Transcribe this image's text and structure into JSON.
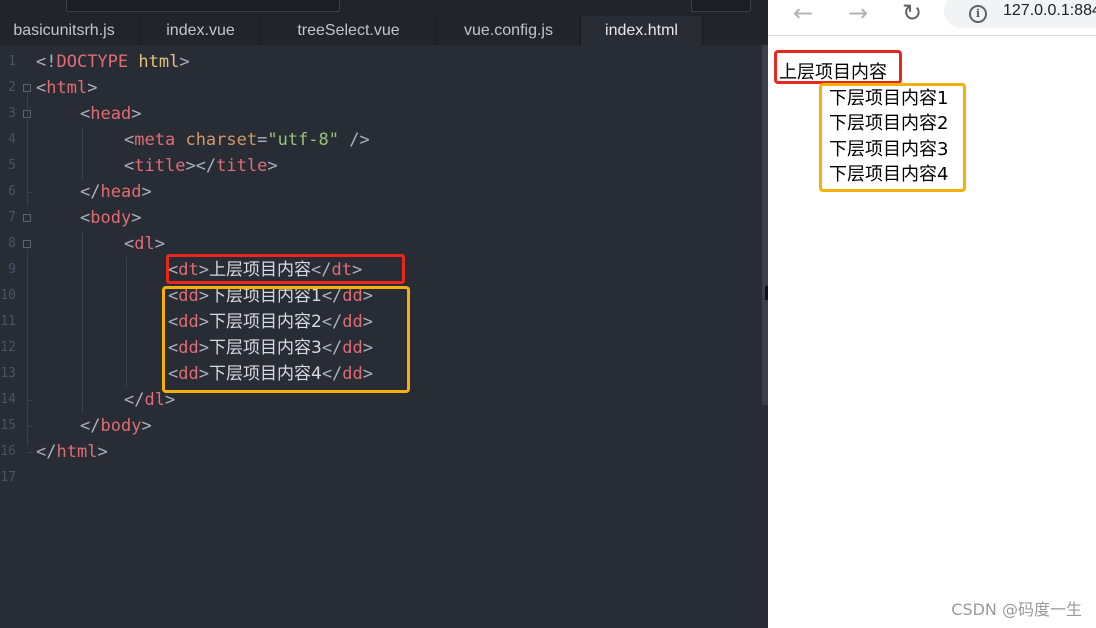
{
  "editor": {
    "tabs": [
      {
        "label": "basicunitsrh.js"
      },
      {
        "label": "index.vue"
      },
      {
        "label": "treeSelect.vue"
      },
      {
        "label": "vue.config.js"
      },
      {
        "label": "index.html",
        "active": true
      }
    ],
    "line_numbers": [
      "1",
      "2",
      "3",
      "4",
      "5",
      "6",
      "7",
      "8",
      "9",
      "10",
      "11",
      "12",
      "13",
      "14",
      "15",
      "16",
      "17"
    ],
    "code": {
      "doctype_open": "<!",
      "doctype_kw": "DOCTYPE",
      "doctype_attr": "html",
      "html_tag": "html",
      "head_tag": "head",
      "meta_tag": "meta",
      "meta_attr": "charset",
      "meta_value": "\"utf-8\"",
      "title_tag": "title",
      "body_tag": "body",
      "dl_tag": "dl",
      "dt_tag": "dt",
      "dd_tag": "dd",
      "dt_text": "上层项目内容",
      "dd_texts": [
        "下层项目内容1",
        "下层项目内容2",
        "下层项目内容3",
        "下层项目内容4"
      ]
    }
  },
  "browser": {
    "back_icon": "←",
    "forward_icon": "→",
    "reload_icon": "↻",
    "info_icon": "i",
    "url": "127.0.0.1:884",
    "page": {
      "dt": "上层项目内容",
      "dd": [
        "下层项目内容1",
        "下层项目内容2",
        "下层项目内容3",
        "下层项目内容4"
      ]
    }
  },
  "annotations": {
    "red": "#e8281c",
    "orange": "#f5b00a"
  },
  "watermark": "CSDN @码度一生"
}
